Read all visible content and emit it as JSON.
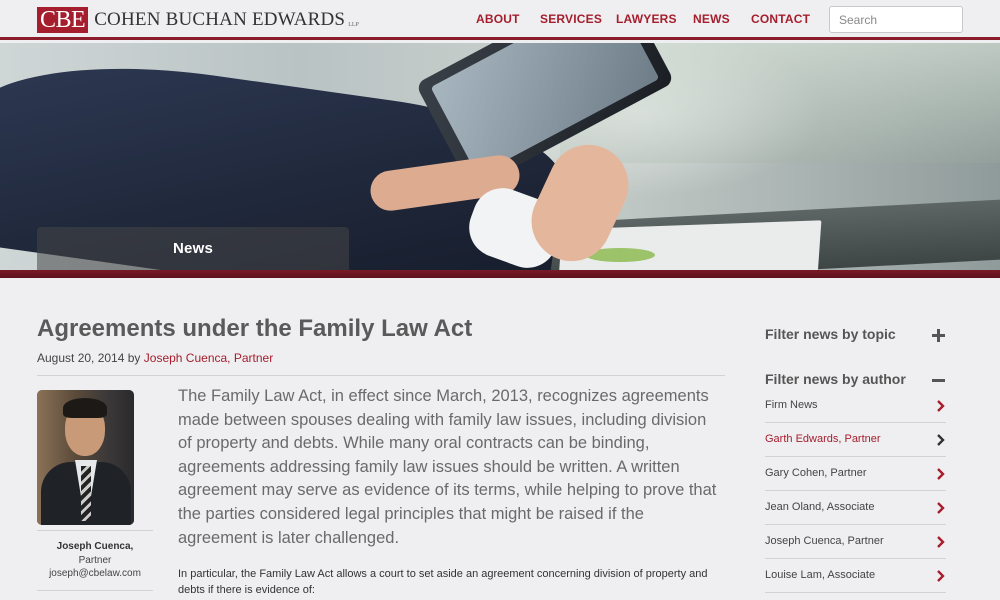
{
  "header": {
    "logo_mark": "CBE",
    "logo_name": "COHEN BUCHAN EDWARDS",
    "logo_suffix": "LLP",
    "nav": [
      {
        "label": "ABOUT"
      },
      {
        "label": "SERVICES"
      },
      {
        "label": "LAWYERS"
      },
      {
        "label": "NEWS"
      },
      {
        "label": "CONTACT"
      }
    ],
    "search_placeholder": "Search"
  },
  "hero": {
    "section_label": "News"
  },
  "article": {
    "title": "Agreements under the Family Law Act",
    "date": "August 20, 2014",
    "by": "by",
    "author_link": "Joseph Cuenca, Partner",
    "lead": "The Family Law Act, in effect since March, 2013, recognizes agreements made between spouses dealing with family law issues, including division of property and debts. While many oral contracts can be binding, agreements addressing family law issues should be written. A written agreement may serve as evidence of its terms, while helping to prove that the parties considered legal principles that might be raised if the agreement is later challenged.",
    "paragraph": "In particular, the Family Law Act allows a court to set aside an agreement concerning division of property and debts if there is evidence of:"
  },
  "author_card": {
    "name": "Joseph Cuenca,",
    "title": "Partner",
    "email": "joseph@cbelaw.com"
  },
  "sidebar": {
    "topic_heading": "Filter news by topic",
    "topic_expanded": false,
    "author_heading": "Filter news by author",
    "author_expanded": true,
    "authors": [
      {
        "label": "Firm News",
        "active": false
      },
      {
        "label": "Garth Edwards, Partner",
        "active": true
      },
      {
        "label": "Gary Cohen, Partner",
        "active": false
      },
      {
        "label": "Jean Oland, Associate",
        "active": false
      },
      {
        "label": "Joseph Cuenca, Partner",
        "active": false
      },
      {
        "label": "Louise Lam, Associate",
        "active": false
      }
    ]
  },
  "colors": {
    "accent": "#a51e2d",
    "band": "#7a1a26",
    "background": "#efeff1"
  }
}
